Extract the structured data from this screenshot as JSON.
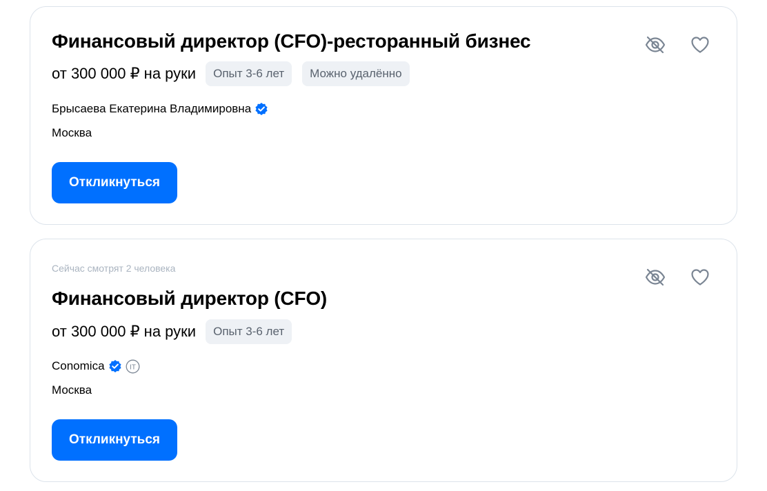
{
  "vacancies": [
    {
      "watching": "",
      "title": "Финансовый директор (CFO)-ресторанный бизнес",
      "salary": "от 300 000 ₽ на руки",
      "tags": [
        "Опыт 3-6 лет",
        "Можно удалённо"
      ],
      "company": "Брысаева Екатерина Владимировна",
      "company_verified": true,
      "company_it": false,
      "city": "Москва",
      "respond_label": "Откликнуться"
    },
    {
      "watching": "Сейчас смотрят 2 человека",
      "title": "Финансовый директор (CFO)",
      "salary": "от 300 000 ₽ на руки",
      "tags": [
        "Опыт 3-6 лет"
      ],
      "company": "Conomica",
      "company_verified": true,
      "company_it": true,
      "it_badge_label": "IT",
      "city": "Москва",
      "respond_label": "Откликнуться"
    }
  ],
  "icons": {
    "hide": "eye-off-icon",
    "favorite": "heart-icon",
    "verified": "verified-check-icon",
    "it": "it-accredited-icon"
  },
  "colors": {
    "accent": "#0070ff",
    "tag_bg": "#eef1f5",
    "tag_text": "#59626e",
    "muted_text": "#aab4c0",
    "icon": "#7a8593",
    "border": "#dce3eb"
  }
}
